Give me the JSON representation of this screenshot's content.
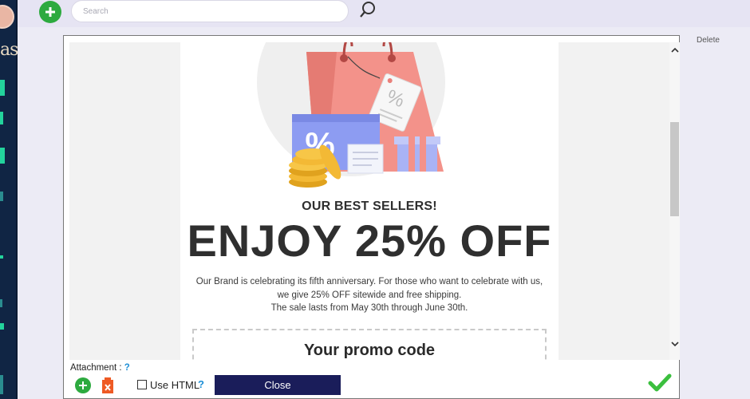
{
  "sidebar": {
    "brand_fragment": "as"
  },
  "topbar": {
    "search": {
      "placeholder": "Search"
    },
    "icons": {
      "add": "plus-icon",
      "search": "magnifier-icon"
    }
  },
  "side_panel": {
    "delete_label": "Delete"
  },
  "email": {
    "subhead": "OUR BEST SELLERS!",
    "headline": "ENJOY 25% OFF",
    "body_line_1": "Our Brand is celebrating its fifth anniversary. For those who want to celebrate with us, we give 25% OFF sitewide and free shipping.",
    "body_line_2": "The sale lasts from May 30th through June 30th.",
    "promo_title": "Your promo code",
    "tag_symbol": "%",
    "card_symbol": "%"
  },
  "footer": {
    "attachment_label": "Attachment :",
    "help_glyph": "?",
    "use_html_label": "Use HTML",
    "close_label": "Close"
  },
  "colors": {
    "accent_green": "#2daa3f",
    "navy": "#1a1d5a",
    "sidebar": "#102544",
    "bag": "#f38c7f"
  }
}
